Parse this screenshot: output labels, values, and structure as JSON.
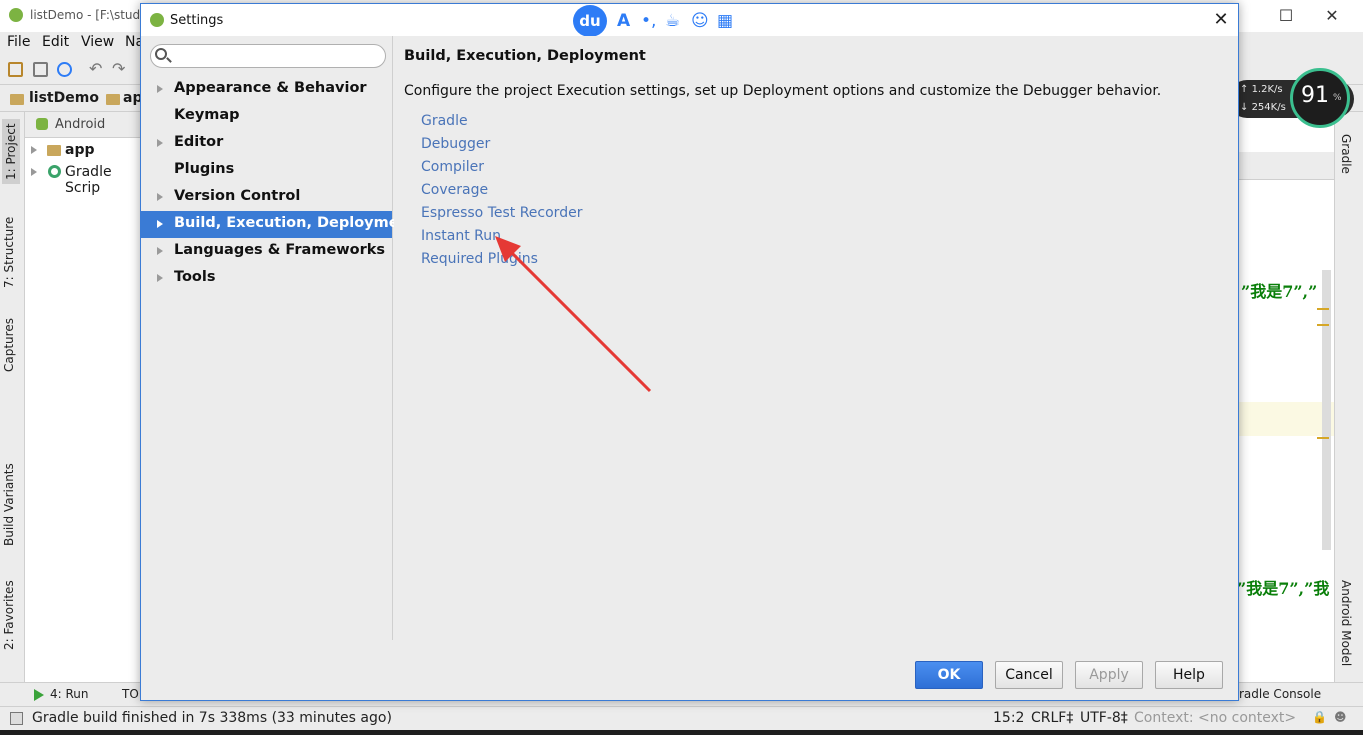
{
  "ide": {
    "window_title": "listDemo - [F:\\studi",
    "menu": [
      "File",
      "Edit",
      "View",
      "Na"
    ],
    "breadcrumb": [
      "listDemo",
      "ap"
    ],
    "project_view": "Android",
    "tree": [
      {
        "label": "app"
      },
      {
        "label": "Gradle Scrip"
      }
    ],
    "left_tabs": [
      "1: Project",
      "7: Structure",
      "Captures",
      "Build Variants",
      "2: Favorites"
    ],
    "right_tabs": [
      "Gradle",
      "Android Model"
    ],
    "editor_snippets": [
      "”我是7”,”",
      "”我是7”,”我"
    ],
    "bottom_tools": {
      "run": "4: Run",
      "todo": "TO",
      "gradle_console": "radle Console"
    },
    "status": {
      "message": "Gradle build finished in 7s 338ms (33 minutes ago)",
      "position": "15:2",
      "line_sep": "CRLF‡",
      "encoding": "UTF-8‡",
      "context": "Context: <no context>"
    }
  },
  "net_widget": {
    "up": "1.2K/s",
    "down": "254K/s",
    "percent": "91",
    "percent_unit": "%"
  },
  "ime": {
    "logo": "du"
  },
  "dialog": {
    "title": "Settings",
    "close_glyph": "✕",
    "search": {
      "value": "",
      "placeholder": ""
    },
    "nav": [
      {
        "label": "Appearance & Behavior",
        "expandable": true,
        "selected": false
      },
      {
        "label": "Keymap",
        "expandable": false,
        "selected": false
      },
      {
        "label": "Editor",
        "expandable": true,
        "selected": false
      },
      {
        "label": "Plugins",
        "expandable": false,
        "selected": false
      },
      {
        "label": "Version Control",
        "expandable": true,
        "selected": false
      },
      {
        "label": "Build, Execution, Deployment",
        "expandable": true,
        "selected": true
      },
      {
        "label": "Languages & Frameworks",
        "expandable": true,
        "selected": false
      },
      {
        "label": "Tools",
        "expandable": true,
        "selected": false
      }
    ],
    "content": {
      "heading": "Build, Execution, Deployment",
      "description": "Configure the project Execution settings, set up Deployment options and customize the Debugger behavior.",
      "links": [
        "Gradle",
        "Debugger",
        "Compiler",
        "Coverage",
        "Espresso Test Recorder",
        "Instant Run",
        "Required Plugins"
      ]
    },
    "buttons": {
      "ok": "OK",
      "cancel": "Cancel",
      "apply": "Apply",
      "help": "Help"
    }
  },
  "colors": {
    "accent": "#3a7bd5",
    "link": "#4a74b8",
    "annotation_arrow": "#e53935"
  }
}
